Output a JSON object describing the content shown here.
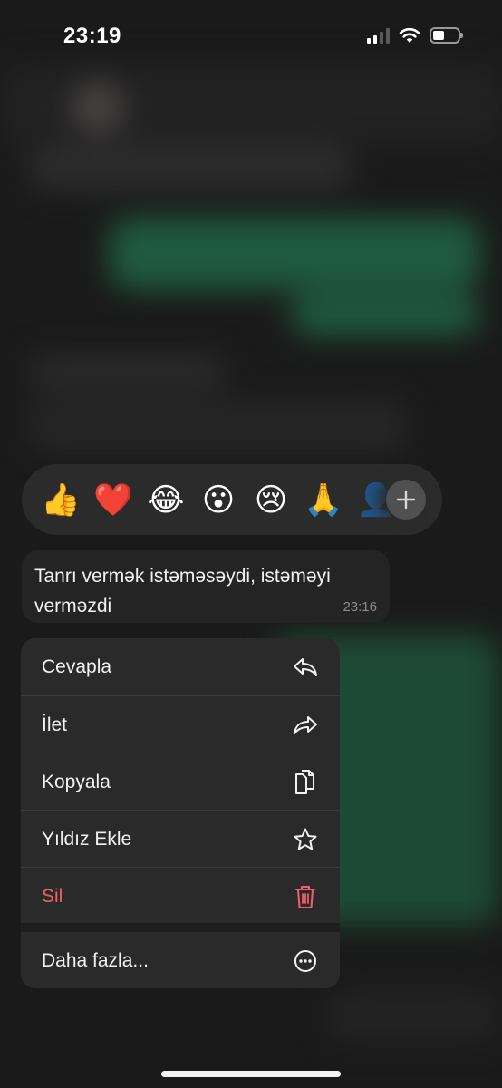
{
  "status_bar": {
    "time": "23:19"
  },
  "reactions": {
    "emojis": [
      "👍",
      "❤️",
      "😂",
      "😮",
      "😢",
      "🙏",
      "👤"
    ],
    "add_icon": "plus-icon"
  },
  "message": {
    "text": "Tanrı vermək istəməsəydi, istəməyi verməzdi",
    "time": "23:16"
  },
  "context_menu": {
    "items": [
      {
        "label": "Cevapla",
        "icon": "reply-icon"
      },
      {
        "label": "İlet",
        "icon": "forward-icon"
      },
      {
        "label": "Kopyala",
        "icon": "copy-icon"
      },
      {
        "label": "Yıldız Ekle",
        "icon": "star-icon"
      },
      {
        "label": "Sil",
        "icon": "trash-icon",
        "destructive": true
      },
      {
        "label": "Daha fazla...",
        "icon": "more-icon"
      }
    ],
    "destructive_color": "#f0606b"
  }
}
